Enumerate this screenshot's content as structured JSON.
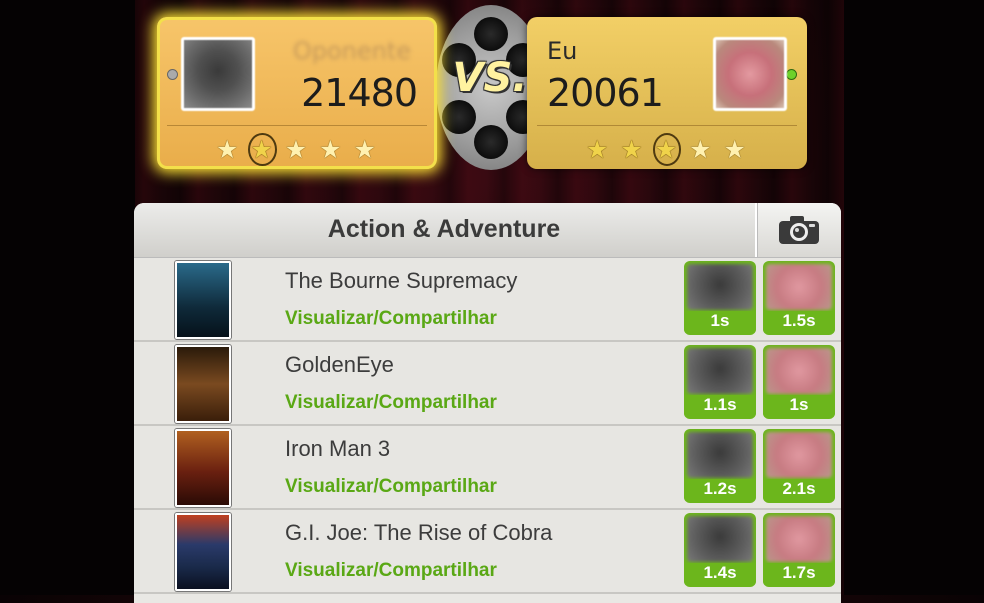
{
  "players": {
    "opponent": {
      "name": "Oponente",
      "score": "21480",
      "stars_total": 5,
      "stars_filled": 1,
      "online": false
    },
    "me": {
      "name": "Eu",
      "score": "20061",
      "stars_total": 5,
      "stars_filled": 3,
      "online": true
    }
  },
  "vs_label": "VS.",
  "category": {
    "title": "Action & Adventure"
  },
  "share_label": "Visualizar/Compartilhar",
  "movies": [
    {
      "title": "The Bourne Supremacy",
      "share": "Visualizar/Compartilhar",
      "opponent_time": "1s",
      "my_time": "1.5s",
      "poster_color": "#0f2a3a"
    },
    {
      "title": "GoldenEye",
      "share": "Visualizar/Compartilhar",
      "opponent_time": "1.1s",
      "my_time": "1s",
      "poster_color": "#5a3010"
    },
    {
      "title": "Iron Man 3",
      "share": "Visualizar/Compartilhar",
      "opponent_time": "1.2s",
      "my_time": "2.1s",
      "poster_color": "#4a1a0c"
    },
    {
      "title": "G.I. Joe: The Rise of Cobra",
      "share": "Visualizar/Compartilhar",
      "opponent_time": "1.4s",
      "my_time": "1.7s",
      "poster_color": "#1a2a4a"
    }
  ],
  "colors": {
    "accent_green": "#6cb61c",
    "card_gold": "#f0c15a",
    "glow": "#ffe436"
  },
  "icons": {
    "camera": "camera-icon",
    "star": "star-icon",
    "reel": "film-reel-icon"
  }
}
